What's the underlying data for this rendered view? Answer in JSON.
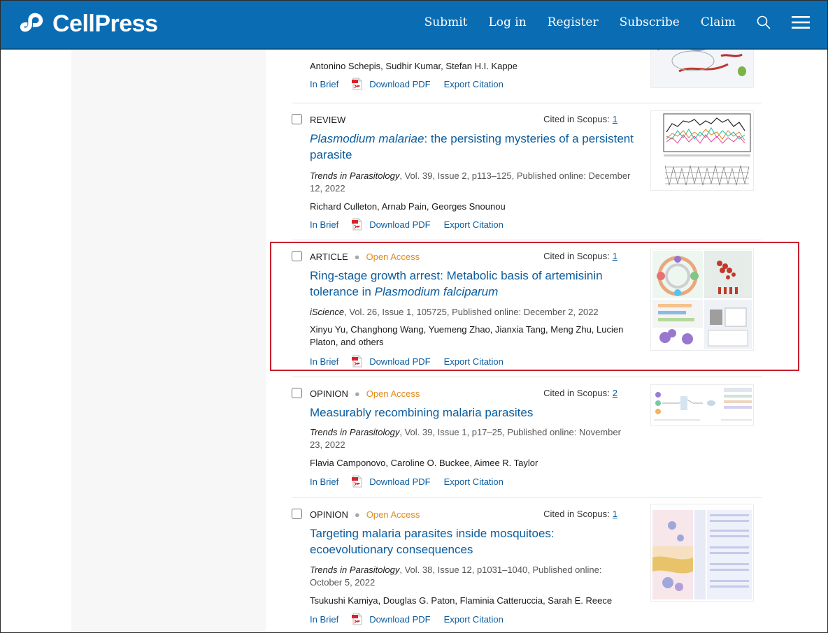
{
  "brand": {
    "name": "CellPress",
    "primary_color": "#0a6db4",
    "link_color": "#0a5c9e",
    "open_access_color": "#e08a1e",
    "highlight_color": "#c8202e"
  },
  "nav": {
    "items": [
      {
        "label": "Submit"
      },
      {
        "label": "Log in"
      },
      {
        "label": "Register"
      },
      {
        "label": "Subscribe"
      },
      {
        "label": "Claim"
      }
    ],
    "search_icon": "search-icon",
    "menu_icon": "hamburger-menu-icon"
  },
  "labels": {
    "cited_prefix": "Cited in Scopus:",
    "in_brief": "In Brief",
    "download_pdf": "Download PDF",
    "export_citation": "Export Citation",
    "open_access": "Open Access"
  },
  "articles": [
    {
      "authors": "Antonino Schepis, Sudhir Kumar, Stefan H.I. Kappe"
    },
    {
      "type": "REVIEW",
      "open_access": false,
      "cited": "1",
      "title_italic": "Plasmodium malariae",
      "title_rest": ": the persisting mysteries of a persistent parasite",
      "journal": "Trends in Parasitology",
      "details": ", Vol. 39, Issue 2, p113–125, Published online: December 12, 2022",
      "authors": "Richard Culleton, Arnab Pain, Georges Snounou"
    },
    {
      "type": "ARTICLE",
      "open_access": true,
      "cited": "1",
      "title_plain": "Ring-stage growth arrest: Metabolic basis of artemisinin tolerance in ",
      "title_italic": "Plasmodium falciparum",
      "journal": "iScience",
      "details": ", Vol. 26, Issue 1, 105725, Published online: December 2, 2022",
      "authors": "Xinyu Yu, Changhong Wang, Yuemeng Zhao, Jianxia Tang, Meng Zhu, Lucien Platon, and others",
      "highlighted": true
    },
    {
      "type": "OPINION",
      "open_access": true,
      "cited": "2",
      "title_plain": "Measurably recombining malaria parasites",
      "journal": "Trends in Parasitology",
      "details": ", Vol. 39, Issue 1, p17–25, Published online: November 23, 2022",
      "authors": "Flavia Camponovo, Caroline O. Buckee, Aimee R. Taylor"
    },
    {
      "type": "OPINION",
      "open_access": true,
      "cited": "1",
      "title_plain": "Targeting malaria parasites inside mosquitoes: ecoevolutionary consequences",
      "journal": "Trends in Parasitology",
      "details": ", Vol. 38, Issue 12, p1031–1040, Published online: October 5, 2022",
      "authors": "Tsukushi Kamiya, Douglas G. Paton, Flaminia Catteruccia, Sarah E. Reece"
    }
  ]
}
